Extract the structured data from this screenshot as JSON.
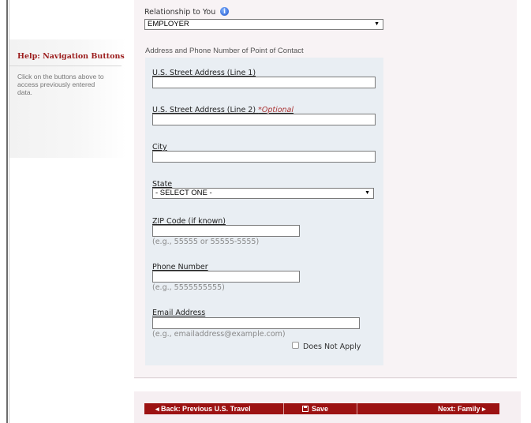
{
  "help": {
    "title": "Help: Navigation Buttons",
    "text": "Click on the buttons above to access previously entered data."
  },
  "relationship": {
    "label": "Relationship to You",
    "value": "EMPLOYER",
    "info_icon": "info-icon"
  },
  "address_heading": "Address and Phone Number of Point of Contact",
  "fields": {
    "street1": {
      "label": "U.S. Street Address (Line 1)",
      "value": ""
    },
    "street2": {
      "label": "U.S. Street Address (Line 2)",
      "optional": "*Optional",
      "value": ""
    },
    "city": {
      "label": "City",
      "value": ""
    },
    "state": {
      "label": "State",
      "value": "- SELECT ONE -"
    },
    "zip": {
      "label": "ZIP Code (if known)",
      "value": "",
      "hint": "(e.g., 55555 or 55555-5555)"
    },
    "phone": {
      "label": "Phone Number",
      "value": "",
      "hint": "(e.g., 5555555555)"
    },
    "email": {
      "label": "Email Address",
      "value": "",
      "hint": "(e.g., emailaddress@example.com)"
    },
    "does_not_apply": {
      "label": "Does Not Apply",
      "checked": false
    }
  },
  "nav": {
    "back_label": "Back: Previous U.S. Travel",
    "save_label": "Save",
    "next_label": "Next: Family",
    "bar_color": "#9c1212"
  }
}
